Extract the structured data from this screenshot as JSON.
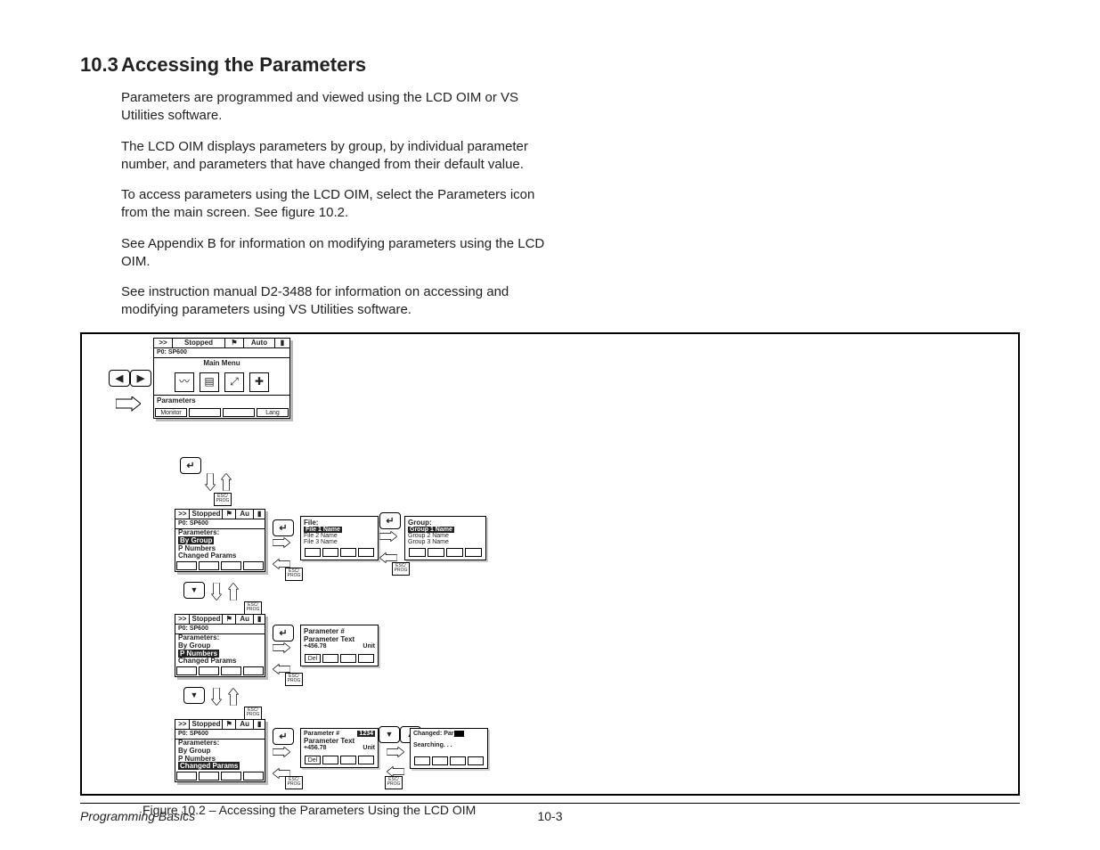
{
  "heading_num": "10.3",
  "heading_txt": "Accessing the Parameters",
  "paragraphs": [
    "Parameters are programmed and viewed using the LCD OIM or VS Utilities software.",
    "The LCD OIM displays parameters by group, by individual parameter number, and parameters that have changed from their default value.",
    "To access parameters using the LCD OIM, select the Parameters icon from the main screen. See figure 10.2.",
    "See Appendix B for information on modifying parameters using the LCD OIM.",
    "See instruction manual D2-3488 for information on accessing and modifying parameters using VS Utilities software."
  ],
  "caption": "Figure 10.2 – Accessing the Parameters Using the LCD OIM",
  "footer_book": "Programming Basics",
  "footer_page": "10-3",
  "screens": {
    "main": {
      "status_l": ">>",
      "status_c": "Stopped",
      "status_r": "Auto",
      "p0": "P0: SP600",
      "title": "Main Menu",
      "tab": "Parameters",
      "sk_l": "Monitor",
      "sk_r": "Lang"
    },
    "m1": {
      "title": "Parameters:",
      "sel": "By Group",
      "r2": "P Numbers",
      "r3": "Changed Params",
      "status": "Stopped",
      "p0": "P0: SP600"
    },
    "m2": {
      "title": "Parameters:",
      "r1": "By Group",
      "sel": "P Numbers",
      "r3": "Changed Params",
      "status": "Stopped",
      "p0": "P0: SP600"
    },
    "m3": {
      "title": "Parameters:",
      "r1": "By Group",
      "r2": "P Numbers",
      "sel": "Changed Params",
      "status": "Stopped",
      "p0": "P0: SP600"
    },
    "file": {
      "title": "File:",
      "sel": "File 1 Name",
      "r2": "File 2 Name",
      "r3": "File 3 Name"
    },
    "group": {
      "title": "Group:",
      "sel": "Group 1 Name",
      "r2": "Group 2 Name",
      "r3": "Group 3 Name"
    },
    "view": {
      "l1": "Parameter #",
      "l2": "Parameter Text",
      "l3": "+456.78",
      "l3r": "Unit"
    },
    "entry": {
      "l1": "Parameter #",
      "l1r": "1234",
      "l2": "Parameter Text",
      "l3": "+456.78",
      "l3r": "Unit",
      "sk": "Del"
    },
    "chg": {
      "title": "Changed: Par",
      "body": "Searching. . ."
    }
  },
  "labels": {
    "esc": "ESC/\nPROG",
    "au": "Au"
  }
}
